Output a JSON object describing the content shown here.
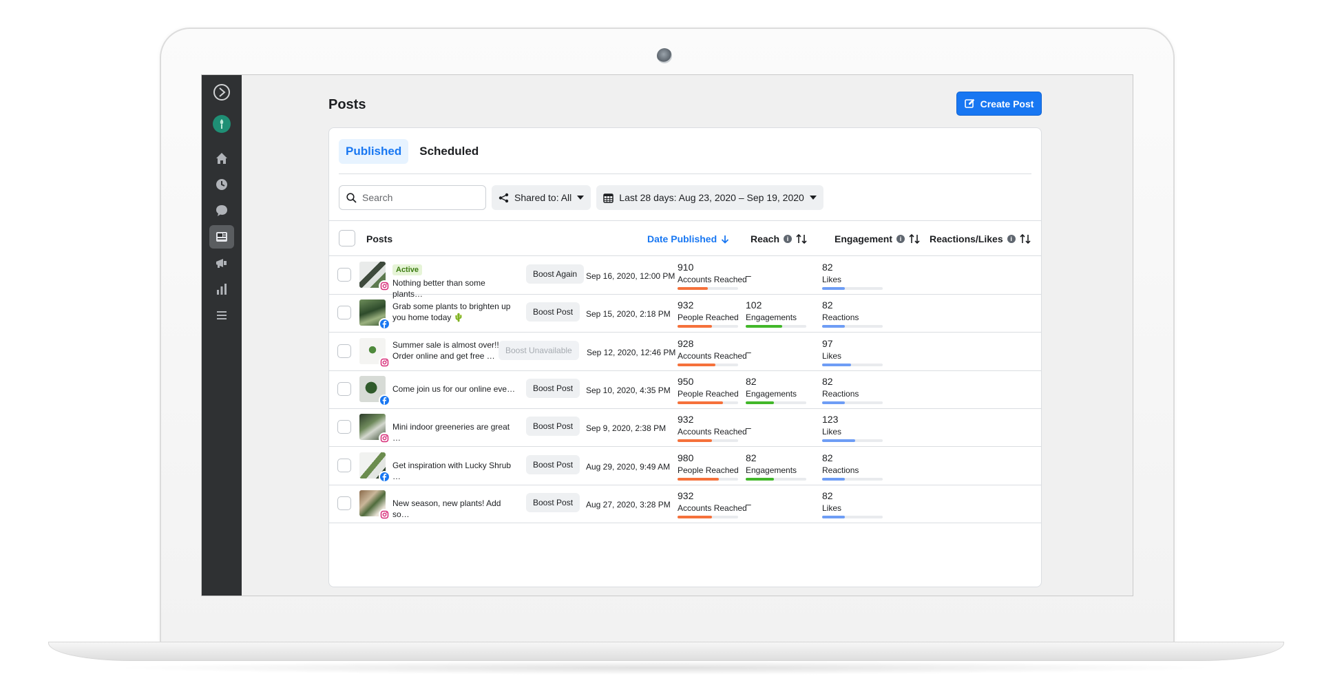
{
  "page": {
    "title": "Posts",
    "create_button": "Create Post"
  },
  "sidebar": {
    "items": [
      "logo-icon",
      "profile-avatar",
      "home-icon",
      "planner-icon",
      "inbox-icon",
      "posts-icon",
      "ads-icon",
      "insights-icon",
      "menu-icon"
    ],
    "active": "posts-icon"
  },
  "tabs": [
    {
      "label": "Published",
      "active": true
    },
    {
      "label": "Scheduled",
      "active": false
    }
  ],
  "filters": {
    "search_placeholder": "Search",
    "shared_to": "Shared to: All",
    "date_range": "Last 28 days: Aug 23, 2020 – Sep 19, 2020"
  },
  "columns": {
    "posts": "Posts",
    "date_published": "Date Published",
    "reach": "Reach",
    "engagement": "Engagement",
    "reactions": "Reactions/Likes"
  },
  "colors": {
    "accent": "#1877f2",
    "reach_bar": "#f5713b",
    "engagement_bar": "#42b72a",
    "reactions_bar": "#6e9df5"
  },
  "rows": [
    {
      "platform": "instagram",
      "badge": "Active",
      "text": "Nothing better than some plants…",
      "boost": "Boost Again",
      "boost_enabled": true,
      "date": "Sep 16, 2020, 12:00 PM",
      "reach": "910",
      "reach_label": "Accounts Reached",
      "reach_fraction": 0.5,
      "engagement": "–",
      "engagement_label": "",
      "engagement_fraction": 0,
      "reactions": "82",
      "reactions_label": "Likes",
      "reactions_fraction": 0.37
    },
    {
      "platform": "facebook",
      "badge": "",
      "text": "Grab some plants to brighten up you home today 🌵",
      "boost": "Boost Post",
      "boost_enabled": true,
      "date": "Sep 15, 2020, 2:18 PM",
      "reach": "932",
      "reach_label": "People Reached",
      "reach_fraction": 0.57,
      "engagement": "102",
      "engagement_label": "Engagements",
      "engagement_fraction": 0.6,
      "reactions": "82",
      "reactions_label": "Reactions",
      "reactions_fraction": 0.37
    },
    {
      "platform": "instagram",
      "badge": "",
      "text": "Summer sale is almost over!! Order online and get free …",
      "boost": "Boost Unavailable",
      "boost_enabled": false,
      "date": "Sep 12, 2020, 12:46 PM",
      "reach": "928",
      "reach_label": "Accounts Reached",
      "reach_fraction": 0.62,
      "engagement": "–",
      "engagement_label": "",
      "engagement_fraction": 0,
      "reactions": "97",
      "reactions_label": "Likes",
      "reactions_fraction": 0.48
    },
    {
      "platform": "facebook",
      "badge": "",
      "text": "Come join us for our online eve…",
      "boost": "Boost Post",
      "boost_enabled": true,
      "date": "Sep 10, 2020, 4:35 PM",
      "reach": "950",
      "reach_label": "People Reached",
      "reach_fraction": 0.75,
      "engagement": "82",
      "engagement_label": "Engagements",
      "engagement_fraction": 0.47,
      "reactions": "82",
      "reactions_label": "Reactions",
      "reactions_fraction": 0.37
    },
    {
      "platform": "instagram",
      "badge": "",
      "text": "Mini indoor greeneries are great …",
      "boost": "Boost Post",
      "boost_enabled": true,
      "date": "Sep 9, 2020, 2:38 PM",
      "reach": "932",
      "reach_label": "Accounts Reached",
      "reach_fraction": 0.57,
      "engagement": "–",
      "engagement_label": "",
      "engagement_fraction": 0,
      "reactions": "123",
      "reactions_label": "Likes",
      "reactions_fraction": 0.54
    },
    {
      "platform": "facebook",
      "badge": "",
      "text": "Get inspiration with Lucky Shrub …",
      "boost": "Boost Post",
      "boost_enabled": true,
      "date": "Aug 29, 2020, 9:49 AM",
      "reach": "980",
      "reach_label": "People Reached",
      "reach_fraction": 0.68,
      "engagement": "82",
      "engagement_label": "Engagements",
      "engagement_fraction": 0.47,
      "reactions": "82",
      "reactions_label": "Reactions",
      "reactions_fraction": 0.37
    },
    {
      "platform": "instagram",
      "badge": "",
      "text": "New season, new plants! Add so…",
      "boost": "Boost Post",
      "boost_enabled": true,
      "date": "Aug 27, 2020, 3:28 PM",
      "reach": "932",
      "reach_label": "Accounts Reached",
      "reach_fraction": 0.57,
      "engagement": "–",
      "engagement_label": "",
      "engagement_fraction": 0,
      "reactions": "82",
      "reactions_label": "Likes",
      "reactions_fraction": 0.37
    }
  ]
}
